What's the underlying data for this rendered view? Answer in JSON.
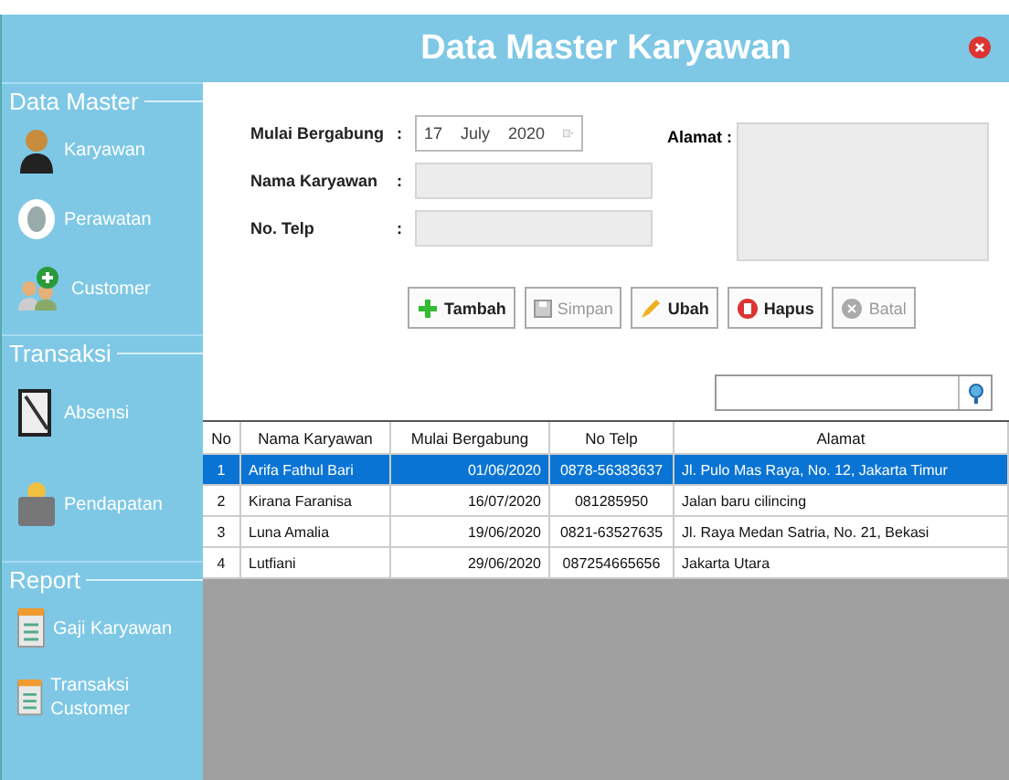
{
  "window": {
    "title": "Data Master Karyawan"
  },
  "sidebar": {
    "sections": [
      {
        "title": "Data Master",
        "items": [
          {
            "label": "Karyawan"
          },
          {
            "label": "Perawatan"
          },
          {
            "label": "Customer"
          }
        ]
      },
      {
        "title": "Transaksi",
        "items": [
          {
            "label": "Absensi"
          },
          {
            "label": "Pendapatan"
          }
        ]
      },
      {
        "title": "Report",
        "items": [
          {
            "label": "Gaji Karyawan"
          },
          {
            "label": "Transaksi Customer"
          }
        ]
      }
    ]
  },
  "form": {
    "join_date": {
      "label": "Mulai Bergabung",
      "colon": ":",
      "day": "17",
      "month": "July",
      "year": "2020"
    },
    "name": {
      "label": "Nama Karyawan",
      "colon": ":"
    },
    "phone": {
      "label": "No. Telp",
      "colon": ":"
    },
    "address": {
      "label": "Alamat :"
    }
  },
  "buttons": [
    {
      "label": "Tambah",
      "disabled": false
    },
    {
      "label": "Simpan",
      "disabled": true
    },
    {
      "label": "Ubah",
      "disabled": false
    },
    {
      "label": "Hapus",
      "disabled": false
    },
    {
      "label": "Batal",
      "disabled": true
    }
  ],
  "table": {
    "columns": [
      "No",
      "Nama Karyawan",
      "Mulai Bergabung",
      "No Telp",
      "Alamat"
    ],
    "rows": [
      {
        "cells": [
          "1",
          "Arifa Fathul Bari",
          "01/06/2020",
          "0878-56383637",
          "Jl. Pulo Mas Raya, No. 12, Jakarta Timur"
        ],
        "selected": true
      },
      {
        "cells": [
          "2",
          "Kirana Faranisa",
          "16/07/2020",
          "081285950",
          "Jalan baru cilincing"
        ],
        "selected": false
      },
      {
        "cells": [
          "3",
          "Luna Amalia",
          "19/06/2020",
          "0821-63527635",
          "Jl. Raya Medan Satria, No. 21, Bekasi"
        ],
        "selected": false
      },
      {
        "cells": [
          "4",
          "Lutfiani",
          "29/06/2020",
          "087254665656",
          "Jakarta Utara"
        ],
        "selected": false
      }
    ]
  }
}
